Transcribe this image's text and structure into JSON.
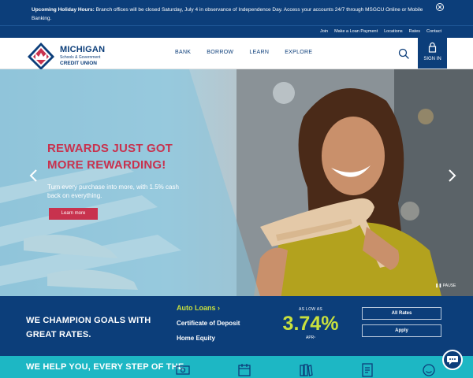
{
  "alert": {
    "label": "Upcoming Holiday Hours:",
    "message": " Branch offices will be closed Saturday, July 4 in observance of Independence Day. Access your accounts 24/7 through MSGCU Online or Mobile Banking."
  },
  "utility_nav": [
    "Join",
    "Make a Loan Payment",
    "Locations",
    "Rates",
    "Contact"
  ],
  "logo": {
    "line1": "MICHIGAN",
    "line2": "Schools & Government",
    "line3": "CREDIT UNION"
  },
  "main_nav": [
    "BANK",
    "BORROW",
    "LEARN",
    "EXPLORE"
  ],
  "sign_in_label": "SIGN IN",
  "hero": {
    "title": "REWARDS JUST GOT MORE REWARDING!",
    "subtitle": "Turn every purchase into more, with 1.5% cash back on everything.",
    "cta": "Learn more",
    "pause_label": "PAUSE"
  },
  "rates": {
    "headline": "WE CHAMPION GOALS WITH GREAT RATES.",
    "products": [
      {
        "label": "Auto Loans",
        "active": true
      },
      {
        "label": "Certificate of Deposit",
        "active": false
      },
      {
        "label": "Home Equity",
        "active": false
      }
    ],
    "as_low_as": "AS LOW AS",
    "rate": "3.74%",
    "apr_label": "APR¹",
    "buttons": [
      "All Rates",
      "Apply"
    ]
  },
  "help": {
    "title": "WE HELP YOU, EVERY STEP OF THE"
  },
  "colors": {
    "navy": "#0c3e7a",
    "accent_red": "#c8324e",
    "rate_green": "#c8e03e",
    "teal": "#1db7c4"
  },
  "icons": [
    "close-circle-icon",
    "search-icon",
    "lock-icon",
    "chevron-left-icon",
    "chevron-right-icon",
    "pause-icon",
    "chat-icon",
    "money-icon",
    "calendar-icon",
    "books-icon",
    "document-icon",
    "smile-icon"
  ]
}
